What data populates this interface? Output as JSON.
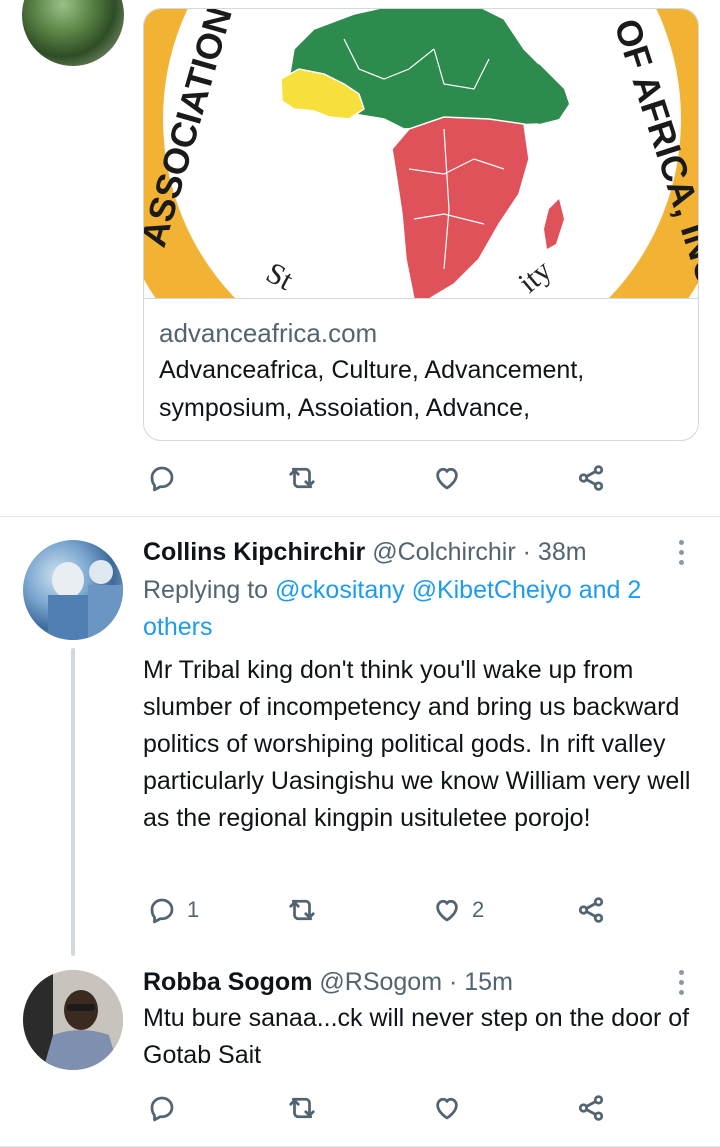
{
  "card": {
    "domain": "advanceafrica.com",
    "description": "Advanceafrica, Culture, Advancement, symposium, Assoiation, Advance,",
    "logo_text_left": "ASSOCIATION FO",
    "logo_text_right": "OF AFRICA, INC",
    "logo_text_bottom_left": "St",
    "logo_text_bottom_right": "ity"
  },
  "tweets": [
    {
      "name": "Collins Kipchirchir",
      "handle": "@Colchirchir",
      "sep": "·",
      "time": "38m",
      "replying_prefix": "Replying to",
      "replying_users": "@ckositany @KibetCheiyo and 2 others",
      "text": "Mr Tribal king don't think you'll wake up from slumber of incompetency and bring us backward politics of worshiping political gods. In rift valley particularly Uasingishu we know William very well as the regional kingpin usituletee porojo!",
      "reply_count": "1",
      "like_count": "2"
    },
    {
      "name": "Robba Sogom",
      "handle": "@RSogom",
      "sep": "·",
      "time": "15m",
      "text": "Mtu bure sanaa...ck will never step on the door of Gotab Sait"
    }
  ],
  "icons": {
    "reply": "reply-icon",
    "retweet": "retweet-icon",
    "like": "heart-icon",
    "share": "share-icon",
    "more": "more-vertical-icon"
  },
  "colors": {
    "link": "#1d9bf0",
    "secondary_text": "#536471",
    "africa_green": "#2e8b4e",
    "africa_red": "#e0525a",
    "africa_yellow": "#f7e03c",
    "ring_orange": "#f2b233"
  }
}
